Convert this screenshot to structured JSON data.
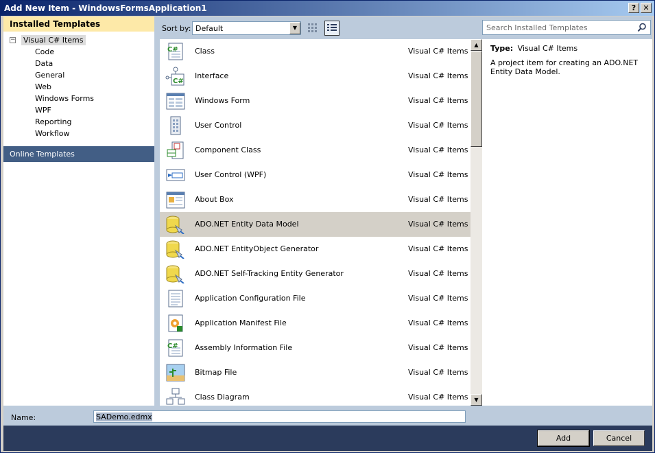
{
  "window": {
    "title": "Add New Item - WindowsFormsApplication1",
    "help_btn": "?",
    "close_btn": "✕"
  },
  "left": {
    "header": "Installed Templates",
    "root": "Visual C# Items",
    "root_expander": "−",
    "children": [
      "Code",
      "Data",
      "General",
      "Web",
      "Windows Forms",
      "WPF",
      "Reporting",
      "Workflow"
    ],
    "online": "Online Templates"
  },
  "sort": {
    "label": "Sort by:",
    "value": "Default"
  },
  "items": [
    {
      "name": "Class",
      "category": "Visual C# Items",
      "icon": "class-icon"
    },
    {
      "name": "Interface",
      "category": "Visual C# Items",
      "icon": "interface-icon"
    },
    {
      "name": "Windows Form",
      "category": "Visual C# Items",
      "icon": "form-icon"
    },
    {
      "name": "User Control",
      "category": "Visual C# Items",
      "icon": "user-control-icon"
    },
    {
      "name": "Component Class",
      "category": "Visual C# Items",
      "icon": "component-icon"
    },
    {
      "name": "User Control (WPF)",
      "category": "Visual C# Items",
      "icon": "wpf-control-icon"
    },
    {
      "name": "About Box",
      "category": "Visual C# Items",
      "icon": "about-box-icon"
    },
    {
      "name": "ADO.NET Entity Data Model",
      "category": "Visual C# Items",
      "icon": "database-icon"
    },
    {
      "name": "ADO.NET EntityObject Generator",
      "category": "Visual C# Items",
      "icon": "database-icon"
    },
    {
      "name": "ADO.NET Self-Tracking Entity Generator",
      "category": "Visual C# Items",
      "icon": "database-icon"
    },
    {
      "name": "Application Configuration File",
      "category": "Visual C# Items",
      "icon": "config-file-icon"
    },
    {
      "name": "Application Manifest File",
      "category": "Visual C# Items",
      "icon": "manifest-icon"
    },
    {
      "name": "Assembly Information File",
      "category": "Visual C# Items",
      "icon": "class-icon"
    },
    {
      "name": "Bitmap File",
      "category": "Visual C# Items",
      "icon": "bitmap-icon"
    },
    {
      "name": "Class Diagram",
      "category": "Visual C# Items",
      "icon": "diagram-icon"
    }
  ],
  "selected_index": 7,
  "search": {
    "placeholder": "Search Installed Templates"
  },
  "details": {
    "type_label": "Type:",
    "type_value": "Visual C# Items",
    "description": "A project item for creating an ADO.NET Entity Data Model."
  },
  "name_field": {
    "label": "Name:",
    "value": "SADemo.edmx"
  },
  "buttons": {
    "add": "Add",
    "cancel": "Cancel"
  }
}
